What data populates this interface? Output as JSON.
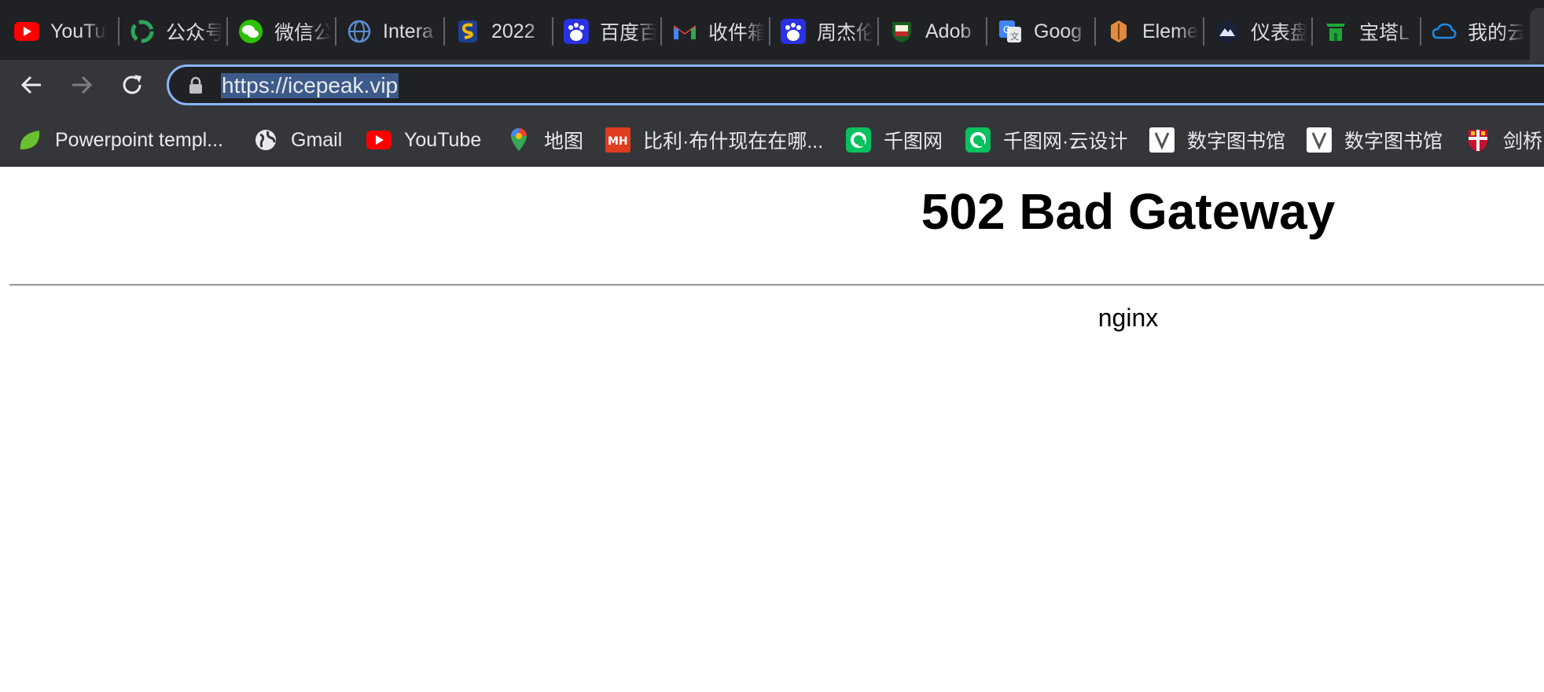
{
  "tabs": [
    {
      "label": "YouTu",
      "icon": "youtube-icon"
    },
    {
      "label": "公众号",
      "icon": "gongzhonghao-icon"
    },
    {
      "label": "微信公",
      "icon": "wechat-icon"
    },
    {
      "label": "Intera",
      "icon": "globe-icon"
    },
    {
      "label": "2022",
      "icon": "s-logo-icon"
    },
    {
      "label": "百度百",
      "icon": "baidu-icon"
    },
    {
      "label": "收件箱",
      "icon": "gmail-icon"
    },
    {
      "label": "周杰伦",
      "icon": "baidu-icon"
    },
    {
      "label": "Adob",
      "icon": "crest-icon"
    },
    {
      "label": "Goog",
      "icon": "google-translate-icon"
    },
    {
      "label": "Eleme",
      "icon": "element-icon"
    },
    {
      "label": "仪表盘",
      "icon": "icepeak-icon"
    },
    {
      "label": "宝塔L",
      "icon": "baota-icon"
    },
    {
      "label": "我的云",
      "icon": "cloud-icon"
    }
  ],
  "toolbar": {
    "back_icon": "arrow-left-icon",
    "forward_icon": "arrow-right-icon",
    "reload_icon": "reload-icon",
    "url": "https://icepeak.vip"
  },
  "bookmarks": [
    {
      "label": "Powerpoint templ...",
      "icon": "leaf-icon"
    },
    {
      "label": "Gmail",
      "icon": "globe-icon"
    },
    {
      "label": "YouTube",
      "icon": "youtube-icon"
    },
    {
      "label": "地图",
      "icon": "maps-pin-icon"
    },
    {
      "label": "比利·布什现在在哪...",
      "icon": "mh-icon"
    },
    {
      "label": "千图网",
      "icon": "qiantu-icon"
    },
    {
      "label": "千图网·云设计",
      "icon": "qiantu-icon"
    },
    {
      "label": "数字图书馆",
      "icon": "v-library-icon"
    },
    {
      "label": "数字图书馆",
      "icon": "v-library-icon"
    },
    {
      "label": "剑桥",
      "icon": "cambridge-crest-icon"
    }
  ],
  "page": {
    "title": "502 Bad Gateway",
    "server": "nginx"
  },
  "colors": {
    "tab_bg": "#202124",
    "toolbar_bg": "#35363a",
    "focus_ring": "#8ab4f8",
    "selection": "#3c5a8a"
  }
}
